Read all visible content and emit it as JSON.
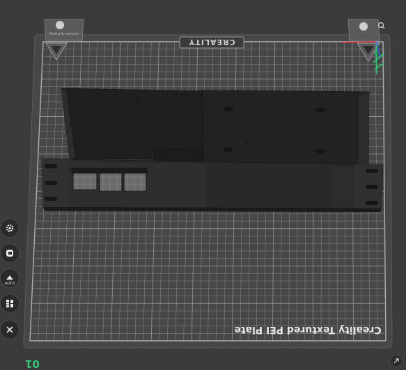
{
  "plate": {
    "name": "Creality Textured PEI Plate",
    "brand": "CREALITY",
    "number": "01",
    "logo_caption": "Printing for everyone"
  },
  "toolbar": {
    "items": [
      {
        "name": "settings-button",
        "icon": "gear-icon"
      },
      {
        "name": "filament-button",
        "icon": "filament-icon"
      },
      {
        "name": "auto-orient-button",
        "icon": "auto-orient-icon",
        "label": "AUTO"
      },
      {
        "name": "arrange-button",
        "icon": "arrange-icon"
      },
      {
        "name": "close-button",
        "icon": "close-icon"
      }
    ]
  },
  "colors": {
    "background": "#3b3b3d",
    "plate": "#4a4a4c",
    "grid": "#8e8e90",
    "model": "#1f1f21",
    "accent_green": "#2ecc71",
    "axis_x": "#e03030",
    "axis_y": "#2ecc71",
    "axis_z": "#3a6cf0"
  }
}
